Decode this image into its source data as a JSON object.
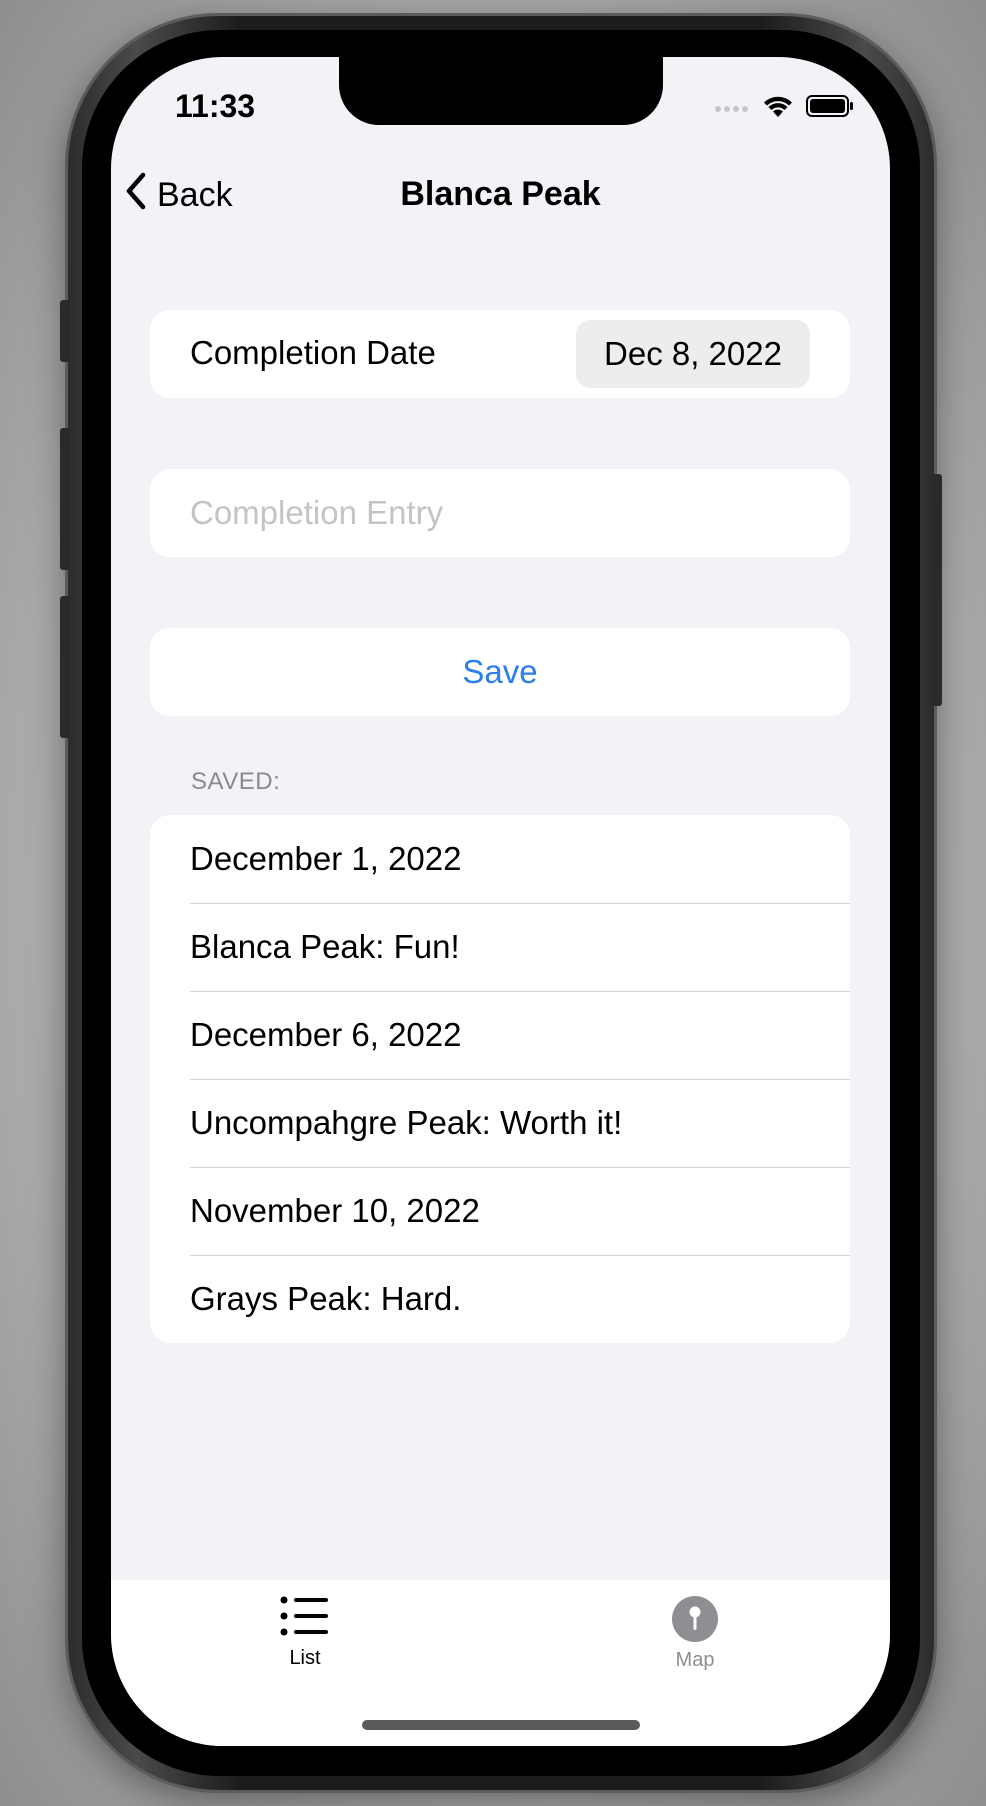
{
  "status_bar": {
    "time": "11:33"
  },
  "nav": {
    "back_label": "Back",
    "title": "Blanca Peak"
  },
  "form": {
    "completion_date_label": "Completion Date",
    "completion_date_value": "Dec 8, 2022",
    "entry_placeholder": "Completion Entry",
    "entry_value": "",
    "save_label": "Save"
  },
  "saved": {
    "header": "SAVED:",
    "items": [
      "December 1, 2022",
      "Blanca Peak: Fun!",
      "December 6, 2022",
      "Uncompahgre Peak: Worth it!",
      "November 10, 2022",
      "Grays Peak: Hard."
    ]
  },
  "tab_bar": {
    "tabs": [
      {
        "label": "List",
        "icon": "list-icon",
        "selected": true
      },
      {
        "label": "Map",
        "icon": "map-pin-icon",
        "selected": false
      }
    ]
  },
  "colors": {
    "accent": "#2a7ef0",
    "background": "#f2f2f7",
    "tab_inactive": "#8e8e93"
  }
}
